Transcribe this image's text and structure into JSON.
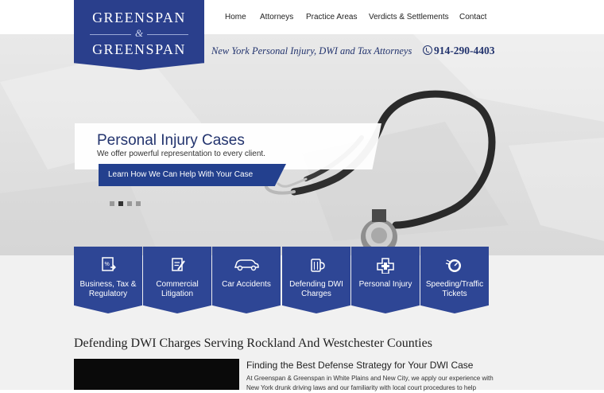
{
  "logo": {
    "line1": "GREENSPAN",
    "line2": "&",
    "line3": "GREENSPAN"
  },
  "nav": {
    "items": [
      {
        "label": "Home"
      },
      {
        "label": "Attorneys"
      },
      {
        "label": "Practice Areas"
      },
      {
        "label": "Verdicts & Settlements"
      },
      {
        "label": "Contact"
      }
    ]
  },
  "header": {
    "tagline": "New York Personal Injury, DWI and Tax Attorneys",
    "phone": "914-290-4403",
    "phone_icon": "phone-icon"
  },
  "slider": {
    "title": "Personal Injury Cases",
    "subtitle": "We offer powerful representation to every client.",
    "cta": "Learn How We Can Help With Your Case",
    "active_dot": 2,
    "dot_count": 4
  },
  "practice_areas": [
    {
      "label": "Business, Tax & Regulatory",
      "icon": "tax-document-icon"
    },
    {
      "label": "Commercial Litigation",
      "icon": "document-pen-icon"
    },
    {
      "label": "Car Accidents",
      "icon": "car-icon"
    },
    {
      "label": "Defending DWI Charges",
      "icon": "beer-mug-icon"
    },
    {
      "label": "Personal Injury",
      "icon": "medical-cross-icon"
    },
    {
      "label": "Speeding/Traffic Tickets",
      "icon": "speedometer-icon"
    }
  ],
  "main": {
    "section_title": "Defending DWI Charges Serving Rockland And Westchester Counties",
    "sub_title": "Finding the Best Defense Strategy for Your DWI Case",
    "paragraph": "At Greenspan & Greenspan in White Plains and New City, we apply our experience with New York drunk driving laws and our familiarity with local court procedures to help"
  },
  "colors": {
    "brand_blue": "#2a3f8c",
    "tile_blue": "#2e4695",
    "accent_text": "#23346e"
  }
}
